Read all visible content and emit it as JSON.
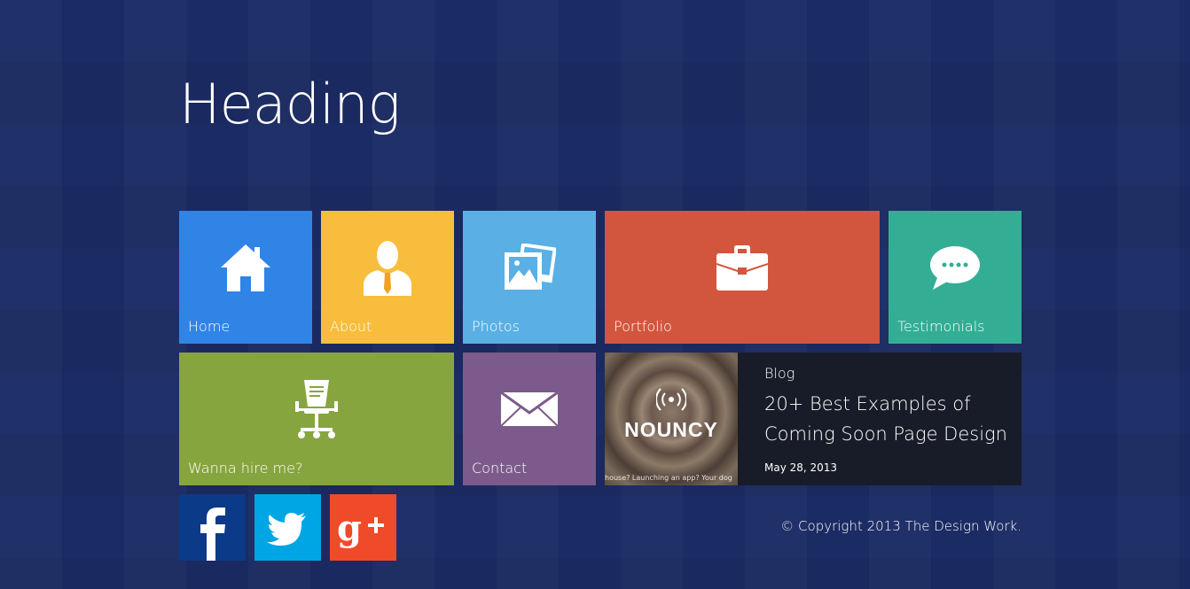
{
  "heading": "Heading",
  "tiles": {
    "home": "Home",
    "about": "About",
    "photos": "Photos",
    "portfolio": "Portfolio",
    "testimonials": "Testimonials",
    "hire": "Wanna hire me?",
    "contact": "Contact"
  },
  "blog": {
    "category": "Blog",
    "title": "20+ Best Examples of Coming Soon Page Design",
    "date": "May 28, 2013",
    "thumbnail_title": "NOUNCY",
    "thumbnail_caption": "house? Launching an app? Your dog"
  },
  "social": {
    "facebook_icon": "facebook-icon",
    "twitter_icon": "twitter-icon",
    "googleplus_icon": "google-plus-icon"
  },
  "footer": {
    "copyright": "© Copyright 2013 The Design Work."
  },
  "colors": {
    "background": "#1b2b64",
    "home": "#3084e6",
    "about": "#f8bd3c",
    "photos": "#5ab0e5",
    "portfolio": "#d2563d",
    "testimonials": "#33ae95",
    "hire": "#87a53f",
    "contact": "#7d5a8c",
    "blog": "#181c28",
    "facebook": "#0b3a88",
    "twitter": "#00a6e4",
    "googleplus": "#ef4a2a"
  }
}
